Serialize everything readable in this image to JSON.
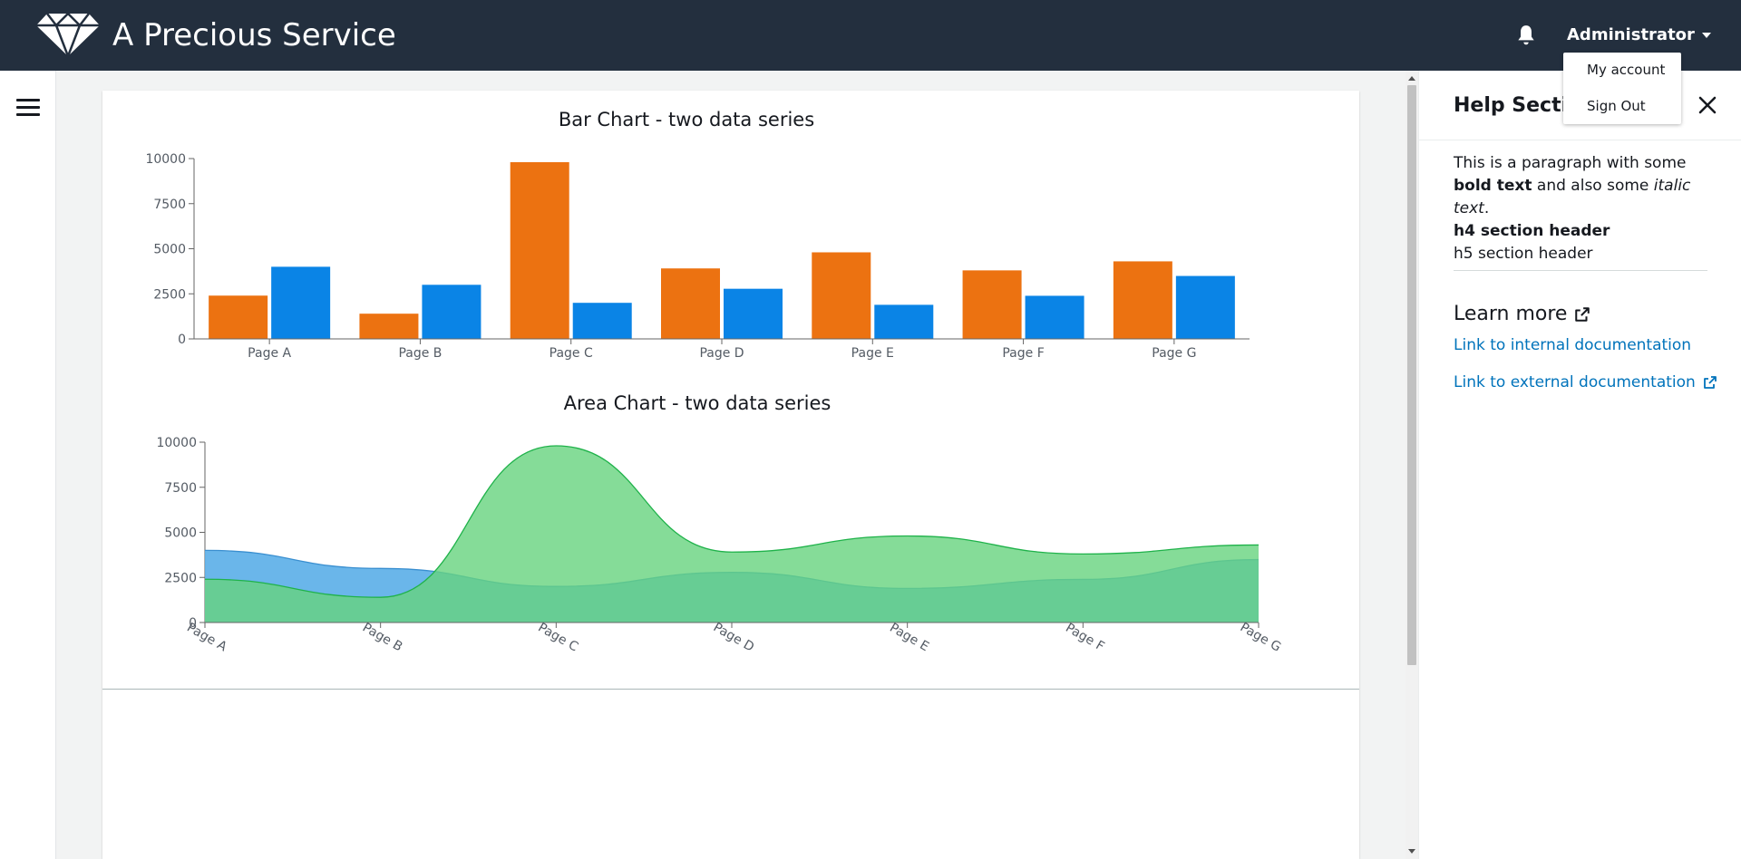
{
  "header": {
    "brand": "A Precious Service",
    "user_label": "Administrator",
    "menu": [
      "My account",
      "Sign Out"
    ]
  },
  "help": {
    "title": "Help Section",
    "para_start": "This is a paragraph with some ",
    "para_bold": "bold text",
    "para_mid": " and also some ",
    "para_italic": "italic text",
    "para_end": ".",
    "h4": "h4 section header",
    "h5": "h5 section header",
    "learn_more": "Learn more",
    "link_internal": "Link to internal documentation",
    "link_external": "Link to external documentation"
  },
  "colors": {
    "topbar": "#232f3e",
    "bar_orange": "#ec7211",
    "bar_blue": "#0a84e6",
    "area_green": "#66d37e",
    "area_blue": "#5aaee8",
    "link": "#0073bb"
  },
  "chart_data": [
    {
      "type": "bar",
      "title": "Bar Chart - two data series",
      "categories": [
        "Page A",
        "Page B",
        "Page C",
        "Page D",
        "Page E",
        "Page F",
        "Page G"
      ],
      "series": [
        {
          "values": [
            2400,
            1398,
            9800,
            3908,
            4800,
            3800,
            4300
          ],
          "color": "#ec7211"
        },
        {
          "values": [
            4000,
            3000,
            2000,
            2780,
            1890,
            2390,
            3490
          ],
          "color": "#0a84e6"
        }
      ],
      "yticks": [
        0,
        2500,
        5000,
        7500,
        10000
      ],
      "ylim": [
        0,
        10000
      ]
    },
    {
      "type": "area",
      "title": "Area Chart - two data series",
      "categories": [
        "Page A",
        "Page B",
        "Page C",
        "Page D",
        "Page E",
        "Page F",
        "Page G"
      ],
      "series": [
        {
          "values": [
            4000,
            3000,
            2000,
            2780,
            1890,
            2390,
            3490
          ],
          "color": "#5aaee8"
        },
        {
          "values": [
            2400,
            1398,
            9800,
            3908,
            4800,
            3800,
            4300
          ],
          "color": "#66d37e"
        }
      ],
      "yticks": [
        0,
        2500,
        5000,
        7500,
        10000
      ],
      "ylim": [
        0,
        10000
      ]
    }
  ]
}
